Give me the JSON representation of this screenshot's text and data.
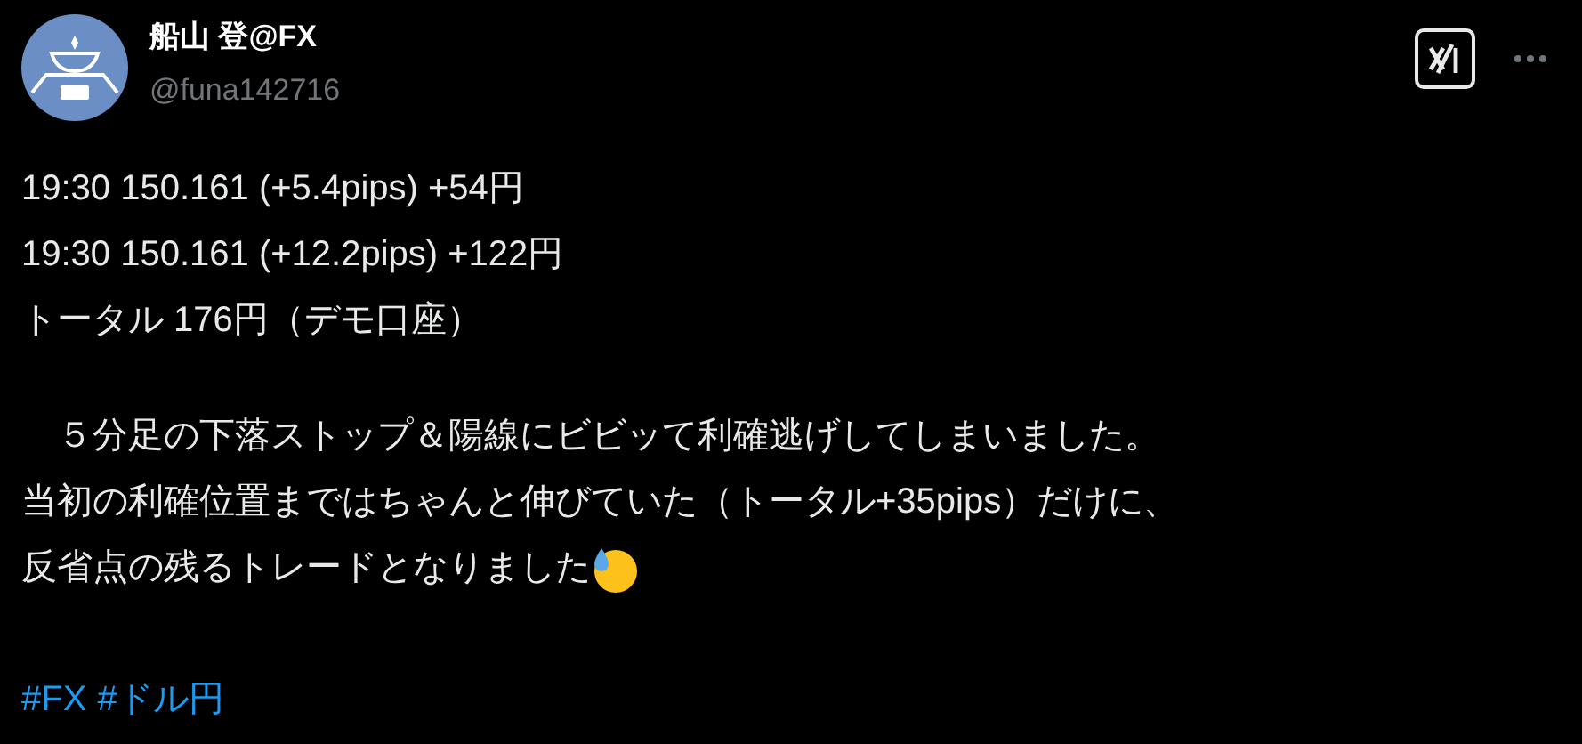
{
  "author": {
    "name": "船山 登@FX",
    "handle": "@funa142716"
  },
  "paragraphs": [
    [
      "19:30 150.161 (+5.4pips) +54円",
      "19:30 150.161 (+12.2pips) +122円",
      "トータル 176円（デモ口座）"
    ],
    [
      "　５分足の下落ストップ＆陽線にビビッて利確逃げしてしまいました。",
      "当初の利確位置まではちゃんと伸びていた（トータル+35pips）だけに、",
      "反省点の残るトレードとなりました"
    ]
  ],
  "hashtags": [
    "#FX",
    "#ドル円"
  ]
}
